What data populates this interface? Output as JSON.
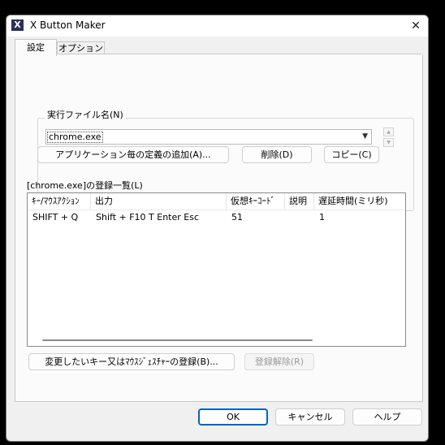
{
  "window": {
    "title": "X Button Maker",
    "close_glyph": "✕",
    "icon_glyph": "X"
  },
  "tabs": [
    {
      "label": "設定"
    },
    {
      "label": "オプション"
    }
  ],
  "exe_group": {
    "label": "実行ファイル名(N)",
    "selected": "chrome.exe",
    "add_button": "アプリケーション毎の定義の追加(A)...",
    "delete_button": "削除(D)",
    "copy_button": "コピー(C)"
  },
  "list": {
    "label": "[chrome.exe]の登録一覧(L)",
    "columns": [
      "ｷｰ/ﾏｳｽｱｸｼｮﾝ",
      "出力",
      "仮想ｷｰｺｰﾄﾞ",
      "説明",
      "遅延時間(ミリ秒)"
    ],
    "rows": [
      [
        "SHIFT + Q",
        "Shift + F10 T Enter Esc",
        "51",
        "",
        "1"
      ]
    ]
  },
  "list_buttons": {
    "change": "変更したいキー又はﾏｳｽｼﾞｪｽﾁｬｰの登録(B)...",
    "unregister": "登録解除(R)"
  },
  "dialog_buttons": {
    "ok": "OK",
    "cancel": "キャンセル",
    "help": "ヘルプ"
  }
}
